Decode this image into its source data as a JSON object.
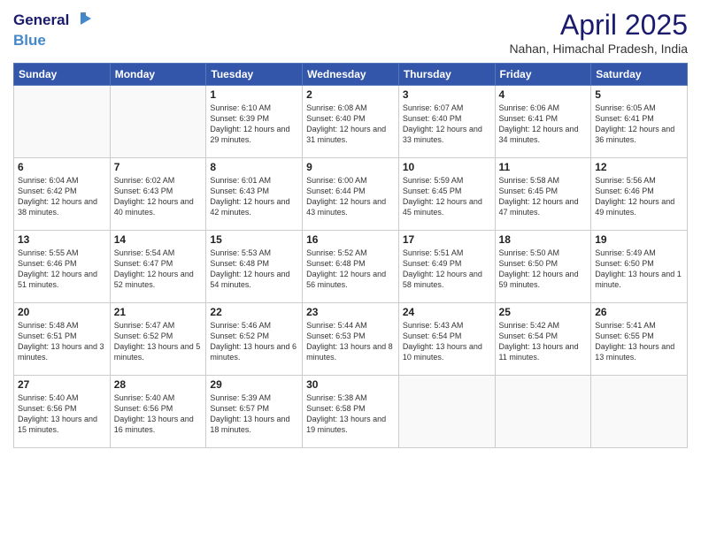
{
  "header": {
    "logo_line1": "General",
    "logo_line2": "Blue",
    "month_title": "April 2025",
    "location": "Nahan, Himachal Pradesh, India"
  },
  "days_of_week": [
    "Sunday",
    "Monday",
    "Tuesday",
    "Wednesday",
    "Thursday",
    "Friday",
    "Saturday"
  ],
  "weeks": [
    [
      {
        "day": "",
        "info": ""
      },
      {
        "day": "",
        "info": ""
      },
      {
        "day": "1",
        "info": "Sunrise: 6:10 AM\nSunset: 6:39 PM\nDaylight: 12 hours and 29 minutes."
      },
      {
        "day": "2",
        "info": "Sunrise: 6:08 AM\nSunset: 6:40 PM\nDaylight: 12 hours and 31 minutes."
      },
      {
        "day": "3",
        "info": "Sunrise: 6:07 AM\nSunset: 6:40 PM\nDaylight: 12 hours and 33 minutes."
      },
      {
        "day": "4",
        "info": "Sunrise: 6:06 AM\nSunset: 6:41 PM\nDaylight: 12 hours and 34 minutes."
      },
      {
        "day": "5",
        "info": "Sunrise: 6:05 AM\nSunset: 6:41 PM\nDaylight: 12 hours and 36 minutes."
      }
    ],
    [
      {
        "day": "6",
        "info": "Sunrise: 6:04 AM\nSunset: 6:42 PM\nDaylight: 12 hours and 38 minutes."
      },
      {
        "day": "7",
        "info": "Sunrise: 6:02 AM\nSunset: 6:43 PM\nDaylight: 12 hours and 40 minutes."
      },
      {
        "day": "8",
        "info": "Sunrise: 6:01 AM\nSunset: 6:43 PM\nDaylight: 12 hours and 42 minutes."
      },
      {
        "day": "9",
        "info": "Sunrise: 6:00 AM\nSunset: 6:44 PM\nDaylight: 12 hours and 43 minutes."
      },
      {
        "day": "10",
        "info": "Sunrise: 5:59 AM\nSunset: 6:45 PM\nDaylight: 12 hours and 45 minutes."
      },
      {
        "day": "11",
        "info": "Sunrise: 5:58 AM\nSunset: 6:45 PM\nDaylight: 12 hours and 47 minutes."
      },
      {
        "day": "12",
        "info": "Sunrise: 5:56 AM\nSunset: 6:46 PM\nDaylight: 12 hours and 49 minutes."
      }
    ],
    [
      {
        "day": "13",
        "info": "Sunrise: 5:55 AM\nSunset: 6:46 PM\nDaylight: 12 hours and 51 minutes."
      },
      {
        "day": "14",
        "info": "Sunrise: 5:54 AM\nSunset: 6:47 PM\nDaylight: 12 hours and 52 minutes."
      },
      {
        "day": "15",
        "info": "Sunrise: 5:53 AM\nSunset: 6:48 PM\nDaylight: 12 hours and 54 minutes."
      },
      {
        "day": "16",
        "info": "Sunrise: 5:52 AM\nSunset: 6:48 PM\nDaylight: 12 hours and 56 minutes."
      },
      {
        "day": "17",
        "info": "Sunrise: 5:51 AM\nSunset: 6:49 PM\nDaylight: 12 hours and 58 minutes."
      },
      {
        "day": "18",
        "info": "Sunrise: 5:50 AM\nSunset: 6:50 PM\nDaylight: 12 hours and 59 minutes."
      },
      {
        "day": "19",
        "info": "Sunrise: 5:49 AM\nSunset: 6:50 PM\nDaylight: 13 hours and 1 minute."
      }
    ],
    [
      {
        "day": "20",
        "info": "Sunrise: 5:48 AM\nSunset: 6:51 PM\nDaylight: 13 hours and 3 minutes."
      },
      {
        "day": "21",
        "info": "Sunrise: 5:47 AM\nSunset: 6:52 PM\nDaylight: 13 hours and 5 minutes."
      },
      {
        "day": "22",
        "info": "Sunrise: 5:46 AM\nSunset: 6:52 PM\nDaylight: 13 hours and 6 minutes."
      },
      {
        "day": "23",
        "info": "Sunrise: 5:44 AM\nSunset: 6:53 PM\nDaylight: 13 hours and 8 minutes."
      },
      {
        "day": "24",
        "info": "Sunrise: 5:43 AM\nSunset: 6:54 PM\nDaylight: 13 hours and 10 minutes."
      },
      {
        "day": "25",
        "info": "Sunrise: 5:42 AM\nSunset: 6:54 PM\nDaylight: 13 hours and 11 minutes."
      },
      {
        "day": "26",
        "info": "Sunrise: 5:41 AM\nSunset: 6:55 PM\nDaylight: 13 hours and 13 minutes."
      }
    ],
    [
      {
        "day": "27",
        "info": "Sunrise: 5:40 AM\nSunset: 6:56 PM\nDaylight: 13 hours and 15 minutes."
      },
      {
        "day": "28",
        "info": "Sunrise: 5:40 AM\nSunset: 6:56 PM\nDaylight: 13 hours and 16 minutes."
      },
      {
        "day": "29",
        "info": "Sunrise: 5:39 AM\nSunset: 6:57 PM\nDaylight: 13 hours and 18 minutes."
      },
      {
        "day": "30",
        "info": "Sunrise: 5:38 AM\nSunset: 6:58 PM\nDaylight: 13 hours and 19 minutes."
      },
      {
        "day": "",
        "info": ""
      },
      {
        "day": "",
        "info": ""
      },
      {
        "day": "",
        "info": ""
      }
    ]
  ]
}
